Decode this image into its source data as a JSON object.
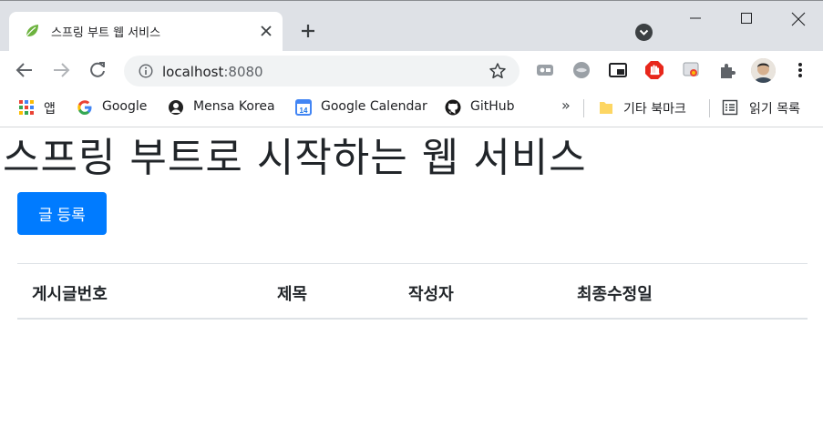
{
  "tab": {
    "title": "스프링 부트 웹 서비스"
  },
  "address_bar": {
    "host": "localhost",
    "port": ":8080"
  },
  "bookmarks": {
    "apps": "앱",
    "items": [
      "Google",
      "Mensa Korea",
      "Google Calendar",
      "GitHub"
    ],
    "calendar_badge": "14",
    "overflow": "»",
    "other": "기타 북마크",
    "reading_list": "읽기 목록"
  },
  "page": {
    "title": "스프링 부트로 시작하는 웹 서비스",
    "register_button": "글 등록",
    "table_headers": [
      "게시글번호",
      "제목",
      "작성자",
      "최종수정일"
    ]
  },
  "colors": {
    "primary": "#007bff",
    "titlebar": "#dee1e6",
    "spring_green": "#6db33f"
  },
  "icons": [
    "spring-leaf-icon",
    "close-icon",
    "plus-icon",
    "tab-search-icon",
    "minimize-icon",
    "maximize-icon",
    "window-close-icon",
    "back-icon",
    "forward-icon",
    "reload-icon",
    "info-icon",
    "star-icon",
    "puzzle-icon",
    "kebab-menu-icon",
    "folder-icon",
    "list-icon"
  ]
}
